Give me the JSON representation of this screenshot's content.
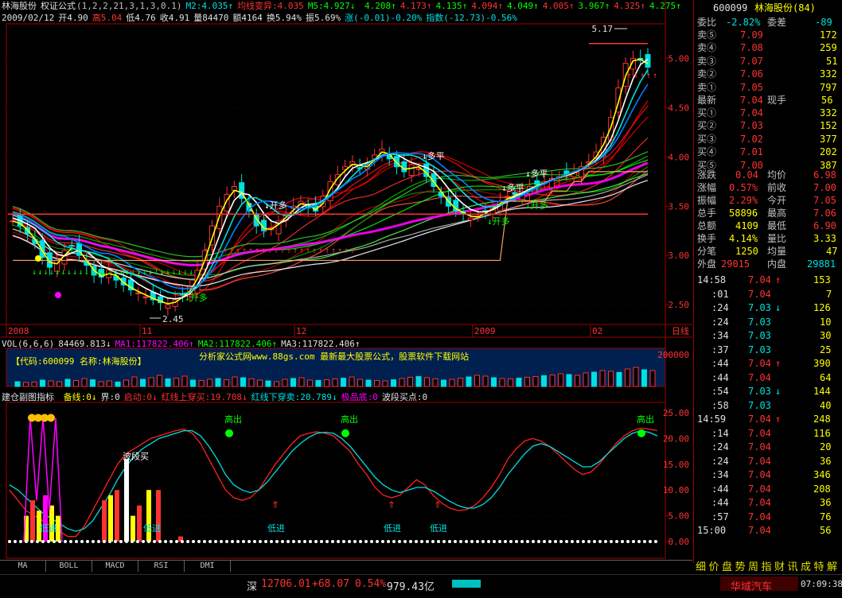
{
  "header": {
    "stock": "林海股份",
    "formula": "权证公式",
    "params": "(1,2,2,21,3,1,3,0.1)",
    "m2": "M2:4.035↑",
    "junxian": "均线变异:4.035",
    "m5": "M5:4.927↓",
    "list": [
      "4.208↑",
      "4.173↑",
      "4.135↑",
      "4.094↑",
      "4.049↑",
      "4.005↑",
      "3.967↑",
      "4.325↑",
      "4.275↑"
    ],
    "line2": {
      "date": "2009/02/12",
      "open": "开4.90",
      "high": "高5.04",
      "low": "低4.76",
      "close": "收4.91",
      "vol": "量84470",
      "amount": "额4164",
      "turnover": "换5.94%",
      "amp": "振5.69%",
      "change": "涨(-0.01)-0.20%",
      "index": "指数(-12.73)-0.56%"
    }
  },
  "main_chart": {
    "y_ticks": [
      "5.00",
      "4.50",
      "4.00",
      "3.50",
      "3.00",
      "2.50"
    ],
    "y_values": [
      5.0,
      4.5,
      4.0,
      3.5,
      3.0,
      2.5
    ],
    "ylim": [
      2.3,
      5.35
    ],
    "x_labels": [
      "2008",
      "11",
      "12",
      "2009",
      "02"
    ],
    "period": "日线",
    "high_label": "5.17",
    "low_label": "2.45",
    "annotations": [
      "多平",
      "多平",
      "多平",
      "开多",
      "开多",
      "开多",
      "开多"
    ],
    "close_series": [
      3.35,
      3.3,
      3.22,
      3.12,
      2.98,
      2.88,
      2.95,
      3.05,
      3.1,
      3.0,
      2.9,
      2.8,
      2.78,
      2.85,
      2.75,
      2.7,
      2.65,
      2.62,
      2.58,
      2.55,
      2.52,
      2.5,
      2.55,
      2.6,
      2.68,
      2.85,
      3.05,
      3.3,
      3.5,
      3.62,
      3.7,
      3.58,
      3.45,
      3.3,
      3.25,
      3.28,
      3.35,
      3.42,
      3.5,
      3.55,
      3.48,
      3.45,
      3.6,
      3.75,
      3.82,
      3.9,
      3.95,
      3.88,
      3.92,
      4.02,
      4.08,
      3.98,
      3.9,
      3.85,
      3.92,
      3.88,
      3.8,
      3.7,
      3.6,
      3.5,
      3.45,
      3.42,
      3.38,
      3.4,
      3.45,
      3.5,
      3.55,
      3.6,
      3.62,
      3.65,
      3.7,
      3.72,
      3.75,
      3.78,
      3.8,
      3.82,
      3.85,
      3.9,
      3.95,
      4.05,
      4.2,
      4.4,
      4.7,
      4.95,
      5.0,
      4.98,
      4.91
    ],
    "vol_line": [
      2.95,
      2.95,
      2.95,
      2.95,
      2.95,
      2.95,
      2.95,
      2.95,
      2.95,
      2.95,
      2.95,
      2.95,
      2.95,
      2.95,
      2.95,
      2.95,
      2.95,
      2.95,
      2.95,
      2.95,
      2.95,
      2.95,
      2.95,
      2.95,
      2.95,
      2.95,
      2.95,
      2.95,
      2.95,
      2.95,
      2.95,
      2.95,
      2.95,
      2.95,
      2.95,
      2.95,
      2.95,
      2.95,
      2.95,
      2.95,
      2.95,
      2.95,
      2.95,
      2.95,
      2.95,
      2.95,
      2.95,
      2.95,
      2.95,
      2.95,
      2.95,
      2.95,
      2.95,
      2.95,
      2.95,
      2.95,
      2.95,
      2.95,
      2.95,
      2.95,
      2.95,
      2.95,
      2.95,
      2.95,
      2.95,
      2.95,
      2.95,
      3.55,
      3.55,
      3.55,
      3.55,
      3.55,
      3.55,
      3.65,
      3.65,
      3.65,
      3.75,
      3.75,
      3.85,
      3.85,
      3.85,
      3.85,
      3.85,
      3.85,
      3.85,
      3.85,
      3.85
    ]
  },
  "vol_panel": {
    "label": "VOL(6,6,6)",
    "vol": "84469.813↓",
    "ma1": "MA1:117822.406↑",
    "ma2": "MA2:117822.406↑",
    "ma3": "MA3:117822.406↑",
    "code_text": "【代码:600099 名称:林海股份】",
    "ad_text": "分析家公式网www.88gs.com 最新最大股票公式，股票软件下载网站",
    "y_tick": "200000",
    "bars": [
      30,
      25,
      28,
      40,
      35,
      30,
      45,
      38,
      50,
      42,
      30,
      35,
      28,
      40,
      60,
      45,
      55,
      70,
      48,
      52,
      65,
      40,
      38,
      45,
      50,
      42,
      60,
      55,
      48,
      40,
      35,
      30,
      45,
      50,
      55,
      40,
      38,
      42,
      48,
      52,
      60,
      45,
      40,
      38,
      35,
      42,
      50,
      58,
      62,
      55,
      48,
      40,
      45,
      52,
      60,
      70,
      65,
      55,
      50,
      48,
      52,
      58,
      62,
      68,
      72,
      80,
      75,
      70,
      85,
      90,
      100,
      95,
      88,
      110,
      120,
      105,
      100
    ]
  },
  "indicator": {
    "title": "建仓副图指标",
    "items": [
      "备线:0↓",
      "界:0",
      "启动:0↓",
      "红线上穿买:19.708↓",
      "红线下穿卖:20.789↓",
      "极品底:0",
      "波段买点:0"
    ],
    "y_ticks": [
      "25.00",
      "20.00",
      "15.00",
      "10.00",
      "5.00",
      "0.00"
    ],
    "y_values": [
      25,
      20,
      15,
      10,
      5,
      0
    ],
    "ylim": [
      -2,
      27
    ],
    "labels_high": [
      "高出",
      "高出",
      "高出"
    ],
    "labels_low": [
      "低进",
      "低进",
      "低进"
    ],
    "labels_low2": [
      "低进",
      "低进"
    ],
    "wave_buy": "波段买",
    "red_line": [
      10,
      8,
      6,
      5,
      4,
      3,
      2,
      1,
      1,
      3,
      6,
      9,
      12,
      15,
      17,
      18,
      19,
      20,
      20.5,
      21,
      21.5,
      21.8,
      21,
      19,
      16,
      13,
      10,
      8.5,
      8,
      8.5,
      10,
      12.5,
      15,
      17,
      19,
      20.5,
      21,
      21.3,
      21,
      20.5,
      19,
      17.5,
      15,
      13,
      10.5,
      9,
      8.5,
      9,
      10.5,
      12,
      11,
      9,
      7.5,
      6.5,
      6,
      6.2,
      7,
      8.5,
      10.5,
      13,
      16,
      18,
      19.5,
      20,
      19.5,
      18.5,
      17,
      15.5,
      14,
      13,
      13.5,
      15,
      17,
      19,
      20.5,
      21.5,
      22,
      21.8,
      21.5
    ],
    "cyan_line": [
      11,
      10,
      8.5,
      7,
      5.5,
      4.5,
      3.5,
      2.5,
      2,
      2.5,
      4,
      6.5,
      9,
      12,
      14.5,
      16.5,
      18,
      19,
      20,
      20.5,
      21,
      21.5,
      21.5,
      20.5,
      18.5,
      16,
      13,
      11,
      10,
      9.5,
      10,
      11.5,
      13.5,
      15.5,
      17.5,
      19,
      20.2,
      21,
      21.2,
      21,
      20,
      18.5,
      16.5,
      14.5,
      12.5,
      11,
      10,
      9.5,
      10,
      10.5,
      10.5,
      9.8,
      8.8,
      7.8,
      7,
      6.5,
      6.5,
      7.2,
      8.5,
      10.5,
      13,
      15,
      17,
      18.5,
      19,
      18.5,
      17.5,
      16.5,
      15.5,
      14.5,
      14.5,
      15.5,
      17,
      18.5,
      20,
      21,
      21.5,
      21.2,
      20.5
    ]
  },
  "quote": {
    "code": "600099",
    "name": "林海股份(84)",
    "weibi_label": "委比",
    "weibi": "-2.82%",
    "weicha_label": "委差",
    "weicha": "-89",
    "sells": [
      {
        "label": "卖⑤",
        "price": "7.09",
        "vol": "172"
      },
      {
        "label": "卖④",
        "price": "7.08",
        "vol": "259"
      },
      {
        "label": "卖③",
        "price": "7.07",
        "vol": "51"
      },
      {
        "label": "卖②",
        "price": "7.06",
        "vol": "332"
      },
      {
        "label": "卖①",
        "price": "7.05",
        "vol": "797"
      }
    ],
    "latest_label": "最新",
    "latest": "7.04",
    "xianshou_label": "现手",
    "xianshou": "56",
    "buys": [
      {
        "label": "买①",
        "price": "7.04",
        "vol": "332"
      },
      {
        "label": "买②",
        "price": "7.03",
        "vol": "152"
      },
      {
        "label": "买③",
        "price": "7.02",
        "vol": "377"
      },
      {
        "label": "买④",
        "price": "7.01",
        "vol": "202"
      },
      {
        "label": "买⑤",
        "price": "7.00",
        "vol": "387"
      }
    ],
    "stats": [
      {
        "l1": "涨跌",
        "v1": "0.04",
        "l2": "均价",
        "v2": "6.98"
      },
      {
        "l1": "涨幅",
        "v1": "0.57%",
        "l2": "前收",
        "v2": "7.00"
      },
      {
        "l1": "振幅",
        "v1": "2.29%",
        "l2": "今开",
        "v2": "7.05"
      },
      {
        "l1": "总手",
        "v1": "58896",
        "l2": "最高",
        "v2": "7.06"
      },
      {
        "l1": "总额",
        "v1": "4109",
        "l2": "最低",
        "v2": "6.90"
      },
      {
        "l1": "换手",
        "v1": "4.14%",
        "l2": "量比",
        "v2": "3.33"
      },
      {
        "l1": "分笔",
        "v1": "1250",
        "l2": "均量",
        "v2": "47"
      }
    ],
    "waipan_label": "外盘",
    "waipan": "29015",
    "neipan_label": "内盘",
    "neipan": "29881",
    "ticks": [
      {
        "t": "14:58",
        "p": "7.04",
        "a": "↑",
        "v": "153"
      },
      {
        "t": ":01",
        "p": "7.04",
        "a": "",
        "v": "7"
      },
      {
        "t": ":24",
        "p": "7.03",
        "a": "↓",
        "v": "126"
      },
      {
        "t": ":24",
        "p": "7.03",
        "a": "",
        "v": "10"
      },
      {
        "t": ":34",
        "p": "7.03",
        "a": "",
        "v": "30"
      },
      {
        "t": ":37",
        "p": "7.03",
        "a": "",
        "v": "25"
      },
      {
        "t": ":44",
        "p": "7.04",
        "a": "↑",
        "v": "390"
      },
      {
        "t": ":44",
        "p": "7.04",
        "a": "",
        "v": "64"
      },
      {
        "t": ":54",
        "p": "7.03",
        "a": "↓",
        "v": "144"
      },
      {
        "t": ":58",
        "p": "7.03",
        "a": "",
        "v": "40"
      },
      {
        "t": "14:59",
        "p": "7.04",
        "a": "↑",
        "v": "248"
      },
      {
        "t": ":14",
        "p": "7.04",
        "a": "",
        "v": "116"
      },
      {
        "t": ":24",
        "p": "7.04",
        "a": "",
        "v": "20"
      },
      {
        "t": ":24",
        "p": "7.04",
        "a": "",
        "v": "36"
      },
      {
        "t": ":34",
        "p": "7.04",
        "a": "",
        "v": "346"
      },
      {
        "t": ":44",
        "p": "7.04",
        "a": "",
        "v": "208"
      },
      {
        "t": ":44",
        "p": "7.04",
        "a": "",
        "v": "36"
      },
      {
        "t": ":57",
        "p": "7.04",
        "a": "",
        "v": "76"
      },
      {
        "t": "15:00",
        "p": "7.04",
        "a": "",
        "v": "56"
      }
    ],
    "bottom_tabs": [
      "细",
      "价",
      "盘",
      "势",
      "周",
      "指",
      "财",
      "讯",
      "成",
      "特",
      "解"
    ]
  },
  "tabs": [
    "MA",
    "BOLL",
    "MACD",
    "RSI",
    "DMI"
  ],
  "status": {
    "market": "深",
    "index": "12706.01",
    "change": "+68.07",
    "pct": "0.54%",
    "amount": "979.43亿",
    "ticker": "华域汽车",
    "time": "07:09:38"
  },
  "colors": {
    "up": "#ff3232",
    "down": "#00e0e0",
    "white": "#ffffff",
    "yellow": "#ffff00",
    "magenta": "#ff00ff",
    "green": "#00ff00",
    "grid": "#a00000"
  }
}
